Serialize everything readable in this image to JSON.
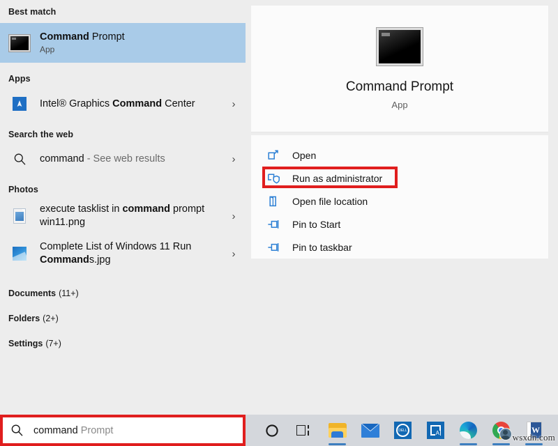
{
  "search": {
    "typed_text": "command",
    "suggestion_text": " Prompt",
    "icon": "search-icon"
  },
  "results": {
    "best_match_header": "Best match",
    "best_match": {
      "title_bold": "Command",
      "title_rest": " Prompt",
      "subtitle": "App",
      "icon": "command-prompt-icon"
    },
    "apps_header": "Apps",
    "apps": [
      {
        "pre": "Intel® Graphics ",
        "bold": "Command",
        "post": " Center",
        "icon": "intel-graphics-command-center-icon",
        "chevron": "›"
      }
    ],
    "web_header": "Search the web",
    "web": [
      {
        "query": "command",
        "suffix": " - See web results",
        "icon": "search-icon",
        "chevron": "›"
      }
    ],
    "photos_header": "Photos",
    "photos": [
      {
        "pre": "execute tasklist in ",
        "bold": "command",
        "post": " prompt win11.png",
        "icon": "png-photo-icon",
        "chevron": "›"
      },
      {
        "pre": "Complete List of Windows 11 Run ",
        "bold": "Command",
        "post": "s.jpg",
        "icon": "jpg-photo-icon",
        "chevron": "›"
      }
    ],
    "categories": [
      {
        "name": "Documents",
        "count": "(11+)"
      },
      {
        "name": "Folders",
        "count": "(2+)"
      },
      {
        "name": "Settings",
        "count": "(7+)"
      }
    ]
  },
  "preview": {
    "app_name": "Command Prompt",
    "app_kind": "App",
    "thumbnail_icon": "command-prompt-large-icon",
    "actions": [
      {
        "label": "Open",
        "icon": "open-window-icon",
        "highlighted": false
      },
      {
        "label": "Run as administrator",
        "icon": "shield-admin-icon",
        "highlighted": true
      },
      {
        "label": "Open file location",
        "icon": "folder-location-icon",
        "highlighted": false
      },
      {
        "label": "Pin to Start",
        "icon": "pin-icon",
        "highlighted": false
      },
      {
        "label": "Pin to taskbar",
        "icon": "pin-icon",
        "highlighted": false
      }
    ]
  },
  "taskbar": {
    "cortana_icon": "cortana-circle-icon",
    "items": [
      {
        "name": "task-view",
        "icon": "task-view-icon",
        "running": false
      },
      {
        "name": "file-explorer",
        "icon": "folder-icon",
        "running": true
      },
      {
        "name": "mail",
        "icon": "mail-icon",
        "running": false
      },
      {
        "name": "dell-app",
        "icon": "dell-icon",
        "running": false
      },
      {
        "name": "translator",
        "icon": "dictionary-icon",
        "running": false
      },
      {
        "name": "microsoft-edge",
        "icon": "edge-icon",
        "running": true
      },
      {
        "name": "google-chrome",
        "icon": "chrome-icon",
        "running": true
      },
      {
        "name": "microsoft-word",
        "icon": "word-icon",
        "running": true
      }
    ]
  },
  "watermark": {
    "text": "wsxdn.com"
  },
  "colors": {
    "selection_blue": "#a9cbe8",
    "annotation_red": "#e01e1e",
    "panel_gray": "#ededed",
    "accent_blue": "#2b7fd4"
  }
}
